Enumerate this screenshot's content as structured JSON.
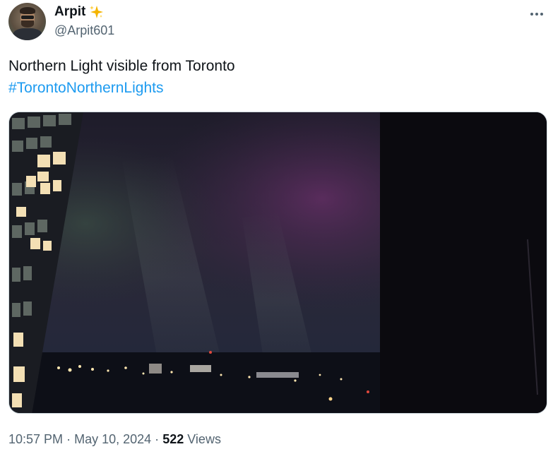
{
  "author": {
    "display_name": "Arpit",
    "handle": "@Arpit601",
    "badge_icon": "sparkles-icon"
  },
  "more_icon": "more-horizontal-icon",
  "tweet": {
    "text_line1": "Northern Light visible from Toronto",
    "hashtag": "#TorontoNorthernLights"
  },
  "media": {
    "description_icon": "photo"
  },
  "meta": {
    "time": "10:57 PM",
    "separator1": "·",
    "date": "May 10, 2024",
    "separator2": "·",
    "views_count": "522",
    "views_label": "Views"
  },
  "colors": {
    "link": "#1d9bf0",
    "secondary_text": "#536471",
    "primary_text": "#0f1419"
  }
}
